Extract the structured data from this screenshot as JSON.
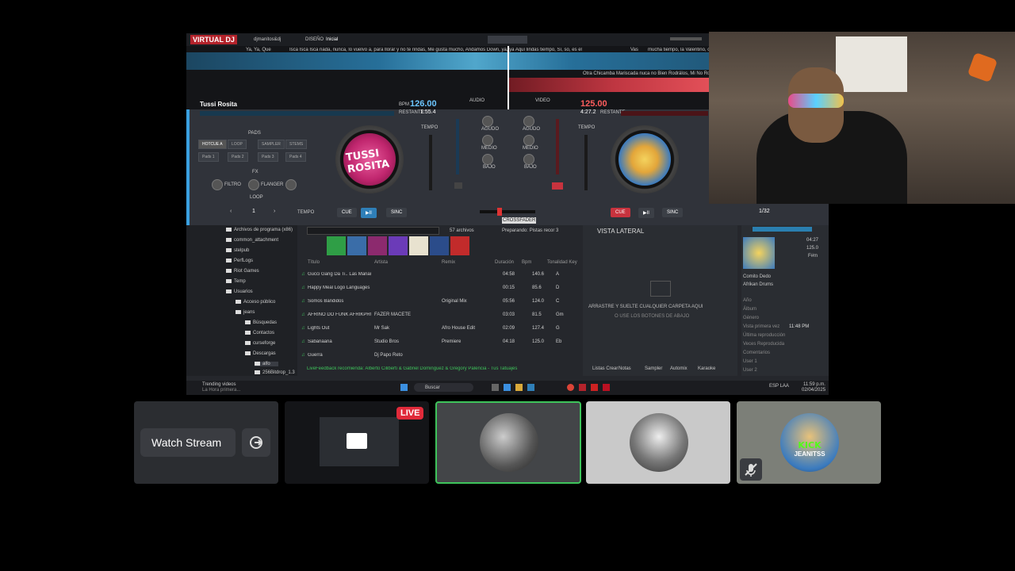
{
  "vdj": {
    "logo": "VIRTUAL DJ",
    "user": "djmanitos&dj",
    "layout_label": "DISEÑO",
    "layout_value": "Inicial",
    "waveform_labels": {
      "top_left": "Ya, Ya, Que",
      "top_track": "Isca Isca Isca nada, nunca, lo vuelvo a, para llorar y no te rindas, Me gusta mucho, Andamos Down, ya, ya Aquí lindas tiempo, Sí, so, es el Tú es, Toy Que tiempo y a es, te Tú es",
      "top_right_tag": "Vas",
      "top_right": "mucha tiempo, la Valentino, corazón...",
      "bottom_track": "Otra Chicamba Mariscada nuca no Bien Rodrálos, Mi No Rodado Rodado"
    },
    "deck_left": {
      "title": "Tussi Rosita",
      "bpm": "126.00",
      "time": "1:55.4",
      "bpm_label": "BPM",
      "time_label": "RESTANTE",
      "pads_header": "PADS",
      "pads": [
        "HOTCUE A",
        "LOOP",
        "SAMPLER",
        "STEMS"
      ],
      "pad_buttons": [
        "Pads 1",
        "Pads 2",
        "Pads 3",
        "Pads 4"
      ],
      "fx_header": "FX",
      "knob_labels": [
        "FILTRO",
        "FLANGER"
      ],
      "loop_label": "LOOP",
      "loop_value": "1",
      "cue": "CUE",
      "play": "▶II",
      "sync": "SINC",
      "pitch_label": "TEMPO",
      "shift": "TEMPO"
    },
    "deck_right": {
      "bpm": "125.00",
      "time": "4:27.2",
      "time_label": "RESTANTE",
      "cue": "CUE",
      "play": "▶II",
      "sync": "SINC",
      "loop_value": "1/32",
      "pitch_label": "TEMPO"
    },
    "mixer": {
      "header_left": "AUDIO",
      "header_right": "VIDEO",
      "knobs": [
        "AGUDO",
        "MEDIO",
        "BAJO",
        "AGUDO",
        "MEDIO",
        "BAJO"
      ],
      "tooltip": "CROSSFADER",
      "tooltip2": "Fader 27%"
    },
    "browser": {
      "tree": [
        "Archivos de programa (x86)",
        "common_attachment",
        "stelpub",
        "PerfLogs",
        "Riot Games",
        "Temp",
        "Usuarios",
        "Acceso público",
        "jeans",
        "Búsquedas",
        "Contactos",
        "curseforge",
        "Descargas",
        "alfo",
        "256Bitdrop_1.3"
      ],
      "search_count": "57 archivos",
      "preparation": "Preparando: Pistas recor 3",
      "columns": [
        "Título",
        "Artista",
        "Remix",
        "Duración",
        "Bpm",
        "Tonalidad Key"
      ],
      "rows": [
        {
          "title": "Gucci Gang Da Ti.. Las Mañanas",
          "artist": "",
          "remix": "",
          "duration": "04:58",
          "bpm": "140.6",
          "key": "A"
        },
        {
          "title": "Happy Meal Logo Languages",
          "artist": "",
          "remix": "",
          "duration": "00:15",
          "bpm": "85.6",
          "key": "D"
        },
        {
          "title": "Somos Bandidos",
          "artist": "",
          "remix": "Original Mix",
          "duration": "05:56",
          "bpm": "124.0",
          "key": "C"
        },
        {
          "title": "AFRINO DO FUNK AFRIKPRO..",
          "artist": "FAZER MACETE",
          "remix": "",
          "duration": "03:03",
          "bpm": "81.5",
          "key": "Gm"
        },
        {
          "title": "Lights Out",
          "artist": "Mr Sak",
          "remix": "Afro House Edit",
          "duration": "02:09",
          "bpm": "127.4",
          "key": "G"
        },
        {
          "title": "Sabanaana",
          "artist": "Studio Bros",
          "remix": "Premiere",
          "duration": "04:18",
          "bpm": "125.0",
          "key": "Eb"
        },
        {
          "title": "Guerra",
          "artist": "Dj Papo Reto",
          "remix": "",
          "duration": "",
          "bpm": "",
          "key": ""
        }
      ],
      "now_playing": "LiveFeedback recomienda: Alberto Ciliberti & Gabriel Dominguez & Gregory Palencia - Tus Tatuajes",
      "side_view_title": "VISTA LATERAL",
      "side_view_hint1": "ARRASTRE Y SUELTE CUALQUIER CARPETA AQUI",
      "side_view_hint2": "O USE LOS BOTONES DE ABAJO",
      "side_buttons": [
        "Listas Crear",
        "Notas",
        "Sampler",
        "Automix",
        "Karaoke"
      ]
    },
    "info": {
      "duration": "04:27",
      "bpm": "125.0",
      "key": "F#m",
      "artist": "Comito Dedo",
      "title": "Afrikan Drums",
      "fields": [
        "Año",
        "Álbum",
        "Género",
        "Vista primera vez",
        "Última reproducción",
        "Veces Reproducida",
        "Comentarios",
        "User 1",
        "User 2"
      ],
      "first_seen_value": "11:48 PM"
    },
    "taskbar": {
      "notification": "Trending videos",
      "notification_sub": "La Hora primera...",
      "search": "Buscar",
      "lang": "ESP\nLAA",
      "time": "11:59 p.m.",
      "date": "02/04/2025"
    }
  },
  "tiles": {
    "watch_stream_label": "Watch Stream",
    "live_badge": "LIVE",
    "kick_line1": "KICK",
    "kick_line2": "JEANITSS"
  },
  "colors": {
    "live_red": "#e02a3a",
    "active_border": "#3ec45b",
    "tile_bg": "#2b2d31",
    "kick_green": "#53fc18"
  }
}
